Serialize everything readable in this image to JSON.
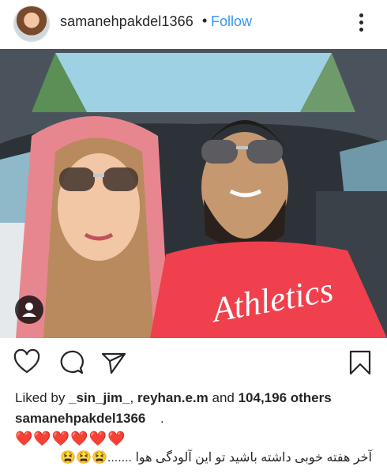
{
  "post": {
    "username": "samanehpakdel1366",
    "separator": "•",
    "follow_label": "Follow",
    "more_icon": "more-options-icon"
  },
  "actions": {
    "like_icon": "heart-outline-icon",
    "comment_icon": "comment-icon",
    "share_icon": "send-icon",
    "save_icon": "bookmark-icon"
  },
  "likes": {
    "prefix": "Liked by ",
    "user1": "_sin_jim_",
    "comma": ", ",
    "user2": "reyhan.e.m",
    "and": " and ",
    "count": "104,196 others"
  },
  "caption": {
    "username": "samanehpakdel1366",
    "text": ".",
    "hearts": "❤️❤️❤️❤️❤️❤️",
    "persian": "آخر هفته خوبی داشته باشید تو این آلودگی هوا .......😫😫😫"
  },
  "colors": {
    "link": "#3897f0",
    "text": "#262626",
    "heart": "#e0302f"
  }
}
